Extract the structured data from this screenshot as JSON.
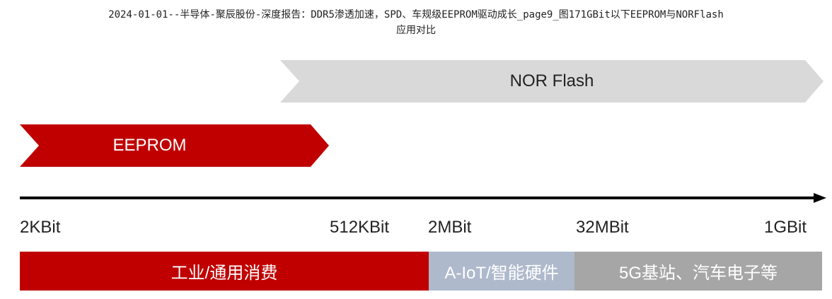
{
  "caption": {
    "line1": "2024-01-01--半导体-聚辰股份-深度报告：DDR5渗透加速，SPD、车规级EEPROM驱动成长_page9_图171GBit以下EEPROM与NORFlash",
    "line2": "应用对比"
  },
  "bands": {
    "nor_flash": "NOR Flash",
    "eeprom": "EEPROM"
  },
  "axis": {
    "ticks": [
      "2KBit",
      "512KBit",
      "2MBit",
      "32MBit",
      "1GBit"
    ]
  },
  "applications": [
    {
      "label": "工业/通用消费",
      "color": "#c00000"
    },
    {
      "label": "A-IoT/智能硬件",
      "color": "#aeb9cc"
    },
    {
      "label": "5G基站、汽车电子等",
      "color": "#a6a6a6"
    }
  ],
  "colors": {
    "eeprom_band": "#c00000",
    "nor_band": "#d9d9d9",
    "axis": "#000000"
  }
}
